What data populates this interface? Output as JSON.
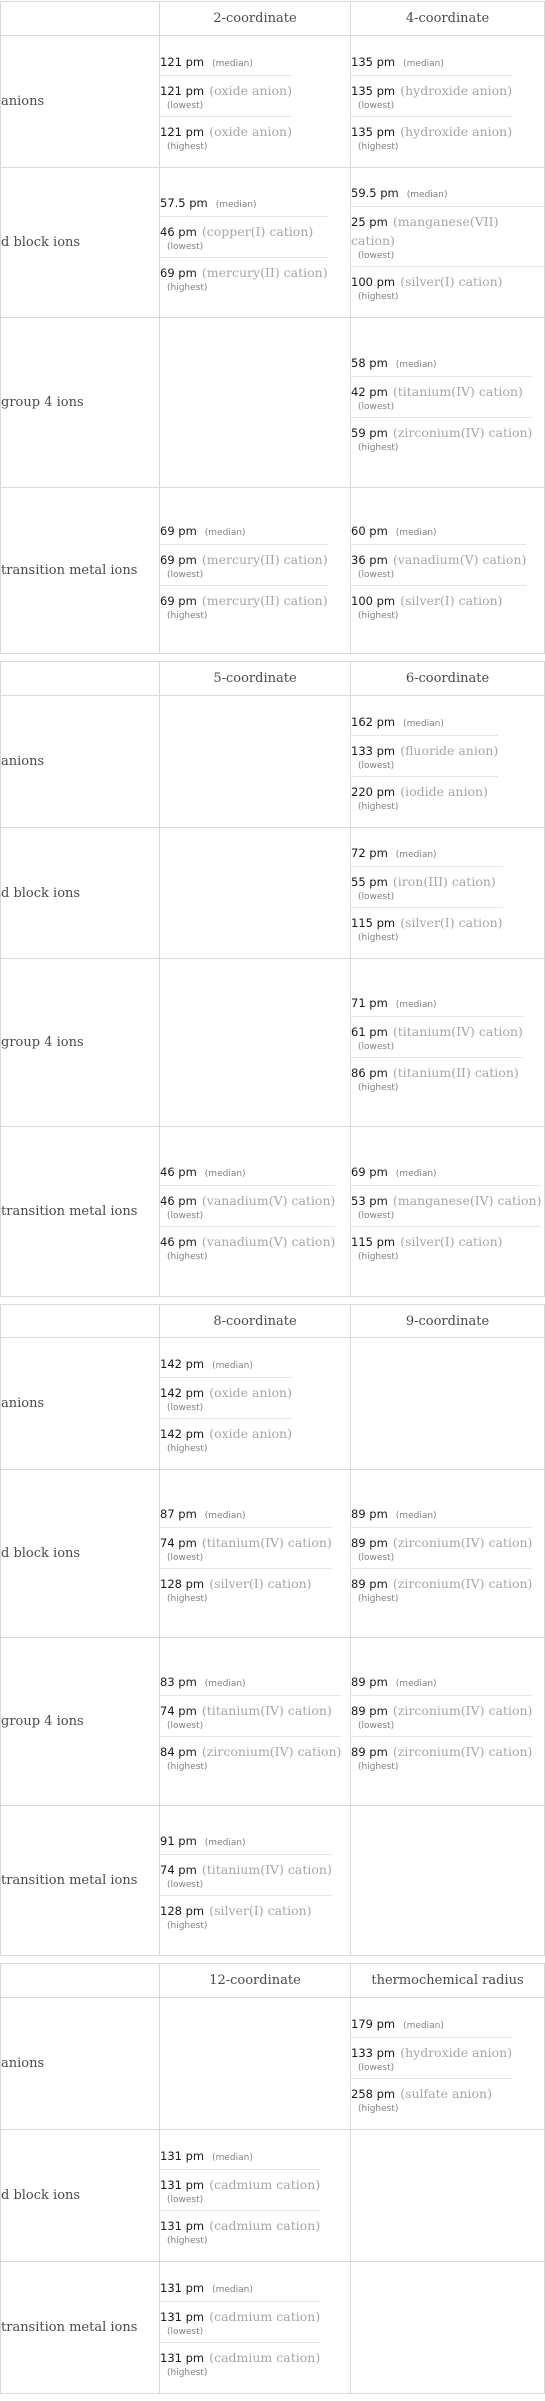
{
  "tables": [
    {
      "columns": [
        "2-coordinate",
        "4-coordinate"
      ],
      "rows": [
        {
          "label": "anions",
          "cells": [
            {
              "median": "121 pm",
              "lowest": {
                "value": "121 pm",
                "ion": "(oxide anion)"
              },
              "highest": {
                "value": "121 pm",
                "ion": "(oxide anion)"
              }
            },
            {
              "median": "135 pm",
              "lowest": {
                "value": "135 pm",
                "ion": "(hydroxide anion)"
              },
              "highest": {
                "value": "135 pm",
                "ion": "(hydroxide anion)"
              }
            }
          ]
        },
        {
          "label": "d block ions",
          "cells": [
            {
              "median": "57.5 pm",
              "lowest": {
                "value": "46 pm",
                "ion": "(copper(I) cation)"
              },
              "highest": {
                "value": "69 pm",
                "ion": "(mercury(II) cation)"
              }
            },
            {
              "median": "59.5 pm",
              "lowest": {
                "value": "25 pm",
                "ion": "(manganese(VII) cation)"
              },
              "highest": {
                "value": "100 pm",
                "ion": "(silver(I) cation)"
              }
            }
          ]
        },
        {
          "label": "group 4 ions",
          "cells": [
            null,
            {
              "median": "58 pm",
              "lowest": {
                "value": "42 pm",
                "ion": "(titanium(IV) cation)"
              },
              "highest": {
                "value": "59 pm",
                "ion": "(zirconium(IV) cation)"
              }
            }
          ]
        },
        {
          "label": "transition metal ions",
          "cells": [
            {
              "median": "69 pm",
              "lowest": {
                "value": "69 pm",
                "ion": "(mercury(II) cation)"
              },
              "highest": {
                "value": "69 pm",
                "ion": "(mercury(II) cation)"
              }
            },
            {
              "median": "60 pm",
              "lowest": {
                "value": "36 pm",
                "ion": "(vanadium(V) cation)"
              },
              "highest": {
                "value": "100 pm",
                "ion": "(silver(I) cation)"
              }
            }
          ]
        }
      ]
    },
    {
      "columns": [
        "5-coordinate",
        "6-coordinate"
      ],
      "rows": [
        {
          "label": "anions",
          "cells": [
            null,
            {
              "median": "162 pm",
              "lowest": {
                "value": "133 pm",
                "ion": "(fluoride anion)"
              },
              "highest": {
                "value": "220 pm",
                "ion": "(iodide anion)"
              }
            }
          ]
        },
        {
          "label": "d block ions",
          "cells": [
            null,
            {
              "median": "72 pm",
              "lowest": {
                "value": "55 pm",
                "ion": "(iron(III) cation)"
              },
              "highest": {
                "value": "115 pm",
                "ion": "(silver(I) cation)"
              }
            }
          ]
        },
        {
          "label": "group 4 ions",
          "cells": [
            null,
            {
              "median": "71 pm",
              "lowest": {
                "value": "61 pm",
                "ion": "(titanium(IV) cation)"
              },
              "highest": {
                "value": "86 pm",
                "ion": "(titanium(II) cation)"
              }
            }
          ]
        },
        {
          "label": "transition metal ions",
          "cells": [
            {
              "median": "46 pm",
              "lowest": {
                "value": "46 pm",
                "ion": "(vanadium(V) cation)"
              },
              "highest": {
                "value": "46 pm",
                "ion": "(vanadium(V) cation)"
              }
            },
            {
              "median": "69 pm",
              "lowest": {
                "value": "53 pm",
                "ion": "(manganese(IV) cation)"
              },
              "highest": {
                "value": "115 pm",
                "ion": "(silver(I) cation)"
              }
            }
          ]
        }
      ]
    },
    {
      "columns": [
        "8-coordinate",
        "9-coordinate"
      ],
      "rows": [
        {
          "label": "anions",
          "cells": [
            {
              "median": "142 pm",
              "lowest": {
                "value": "142 pm",
                "ion": "(oxide anion)"
              },
              "highest": {
                "value": "142 pm",
                "ion": "(oxide anion)"
              }
            },
            null
          ]
        },
        {
          "label": "d block ions",
          "cells": [
            {
              "median": "87 pm",
              "lowest": {
                "value": "74 pm",
                "ion": "(titanium(IV) cation)"
              },
              "highest": {
                "value": "128 pm",
                "ion": "(silver(I) cation)"
              }
            },
            {
              "median": "89 pm",
              "lowest": {
                "value": "89 pm",
                "ion": "(zirconium(IV) cation)"
              },
              "highest": {
                "value": "89 pm",
                "ion": "(zirconium(IV) cation)"
              }
            }
          ]
        },
        {
          "label": "group 4 ions",
          "cells": [
            {
              "median": "83 pm",
              "lowest": {
                "value": "74 pm",
                "ion": "(titanium(IV) cation)"
              },
              "highest": {
                "value": "84 pm",
                "ion": "(zirconium(IV) cation)"
              }
            },
            {
              "median": "89 pm",
              "lowest": {
                "value": "89 pm",
                "ion": "(zirconium(IV) cation)"
              },
              "highest": {
                "value": "89 pm",
                "ion": "(zirconium(IV) cation)"
              }
            }
          ]
        },
        {
          "label": "transition metal ions",
          "cells": [
            {
              "median": "91 pm",
              "lowest": {
                "value": "74 pm",
                "ion": "(titanium(IV) cation)"
              },
              "highest": {
                "value": "128 pm",
                "ion": "(silver(I) cation)"
              }
            },
            null
          ]
        }
      ]
    },
    {
      "columns": [
        "12-coordinate",
        "thermochemical radius"
      ],
      "rows": [
        {
          "label": "anions",
          "cells": [
            null,
            {
              "median": "179 pm",
              "lowest": {
                "value": "133 pm",
                "ion": "(hydroxide anion)"
              },
              "highest": {
                "value": "258 pm",
                "ion": "(sulfate anion)"
              }
            }
          ]
        },
        {
          "label": "d block ions",
          "cells": [
            {
              "median": "131 pm",
              "lowest": {
                "value": "131 pm",
                "ion": "(cadmium cation)"
              },
              "highest": {
                "value": "131 pm",
                "ion": "(cadmium cation)"
              }
            },
            null
          ]
        },
        {
          "label": "transition metal ions",
          "cells": [
            {
              "median": "131 pm",
              "lowest": {
                "value": "131 pm",
                "ion": "(cadmium cation)"
              },
              "highest": {
                "value": "131 pm",
                "ion": "(cadmium cation)"
              }
            },
            null
          ]
        }
      ]
    }
  ],
  "labels": {
    "median": "(median)",
    "lowest": "(lowest)",
    "highest": "(highest)"
  }
}
